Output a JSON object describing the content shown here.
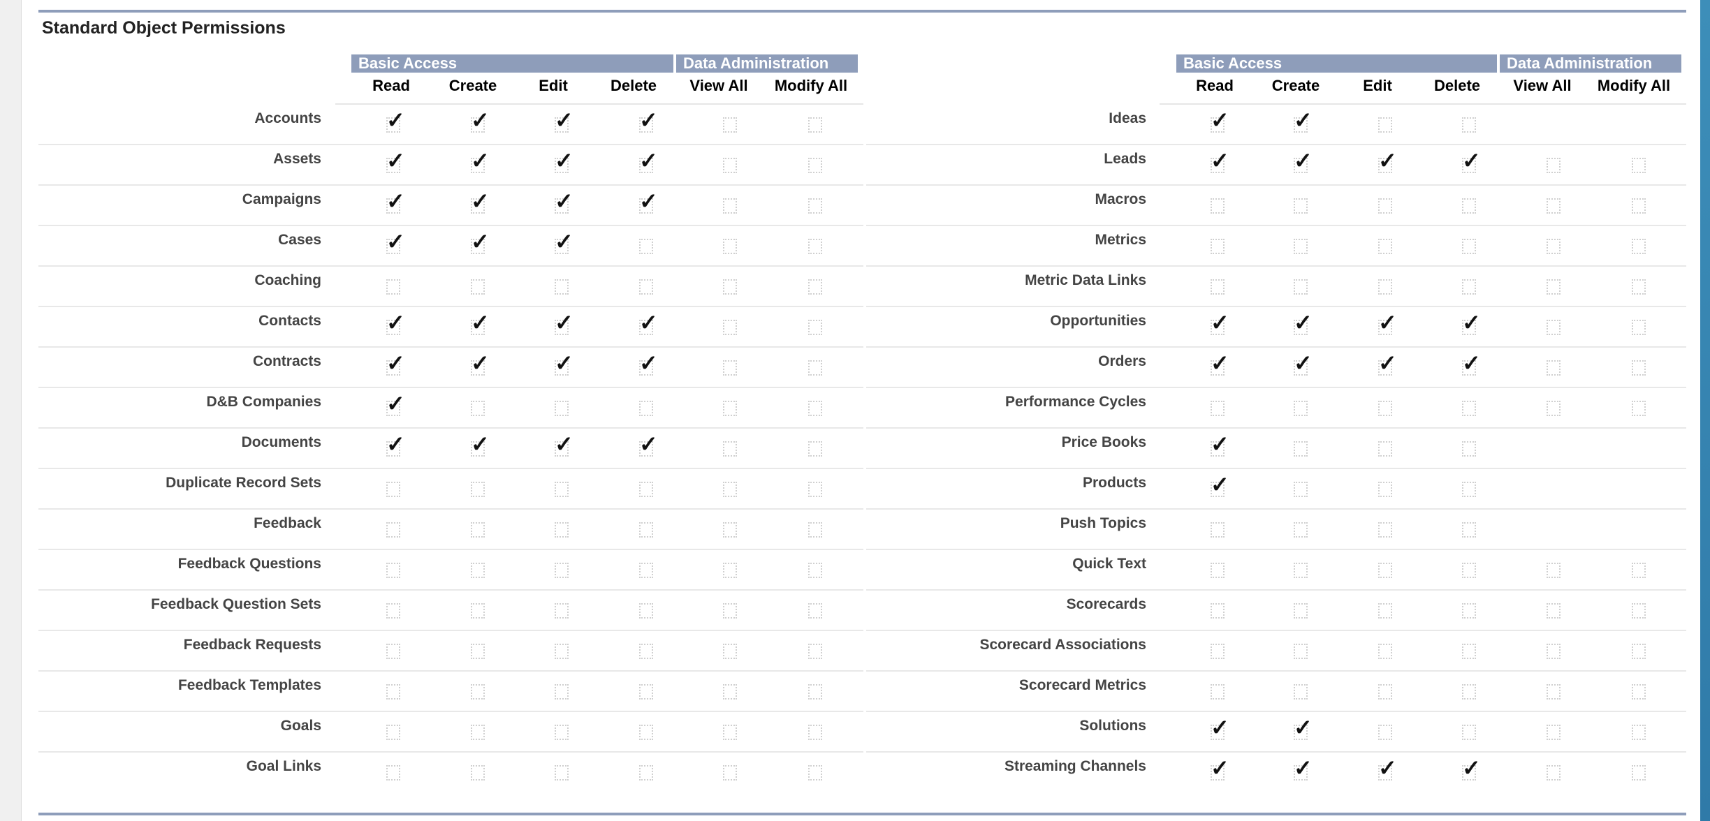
{
  "section": {
    "title": "Standard Object Permissions"
  },
  "header": {
    "group_basic": "Basic Access",
    "group_admin": "Data Administration",
    "columns": [
      "Read",
      "Create",
      "Edit",
      "Delete",
      "View All",
      "Modify All"
    ]
  },
  "icons": {
    "checked": "checkmark-icon",
    "unchecked": "empty-checkbox"
  },
  "colors": {
    "band": "#8e9dba",
    "rule": "#8e9dba",
    "right_strip": "#3d8eb9"
  },
  "left_table": {
    "rows": [
      {
        "name": "Accounts",
        "perms": [
          true,
          true,
          true,
          true,
          false,
          false
        ]
      },
      {
        "name": "Assets",
        "perms": [
          true,
          true,
          true,
          true,
          false,
          false
        ]
      },
      {
        "name": "Campaigns",
        "perms": [
          true,
          true,
          true,
          true,
          false,
          false
        ]
      },
      {
        "name": "Cases",
        "perms": [
          true,
          true,
          true,
          false,
          false,
          false
        ]
      },
      {
        "name": "Coaching",
        "perms": [
          false,
          false,
          false,
          false,
          false,
          false
        ]
      },
      {
        "name": "Contacts",
        "perms": [
          true,
          true,
          true,
          true,
          false,
          false
        ]
      },
      {
        "name": "Contracts",
        "perms": [
          true,
          true,
          true,
          true,
          false,
          false
        ]
      },
      {
        "name": "D&B Companies",
        "perms": [
          true,
          false,
          false,
          false,
          false,
          false
        ]
      },
      {
        "name": "Documents",
        "perms": [
          true,
          true,
          true,
          true,
          false,
          false
        ]
      },
      {
        "name": "Duplicate Record Sets",
        "perms": [
          false,
          false,
          false,
          false,
          false,
          false
        ]
      },
      {
        "name": "Feedback",
        "perms": [
          false,
          false,
          false,
          false,
          false,
          false
        ]
      },
      {
        "name": "Feedback Questions",
        "perms": [
          false,
          false,
          false,
          false,
          false,
          false
        ]
      },
      {
        "name": "Feedback Question Sets",
        "perms": [
          false,
          false,
          false,
          false,
          false,
          false
        ]
      },
      {
        "name": "Feedback Requests",
        "perms": [
          false,
          false,
          false,
          false,
          false,
          false
        ]
      },
      {
        "name": "Feedback Templates",
        "perms": [
          false,
          false,
          false,
          false,
          false,
          false
        ]
      },
      {
        "name": "Goals",
        "perms": [
          false,
          false,
          false,
          false,
          false,
          false
        ]
      },
      {
        "name": "Goal Links",
        "perms": [
          false,
          false,
          false,
          false,
          false,
          false
        ]
      }
    ]
  },
  "right_table": {
    "rows": [
      {
        "name": "Ideas",
        "perms": [
          true,
          true,
          false,
          false,
          null,
          null
        ]
      },
      {
        "name": "Leads",
        "perms": [
          true,
          true,
          true,
          true,
          false,
          false
        ]
      },
      {
        "name": "Macros",
        "perms": [
          false,
          false,
          false,
          false,
          false,
          false
        ]
      },
      {
        "name": "Metrics",
        "perms": [
          false,
          false,
          false,
          false,
          false,
          false
        ]
      },
      {
        "name": "Metric Data Links",
        "perms": [
          false,
          false,
          false,
          false,
          false,
          false
        ]
      },
      {
        "name": "Opportunities",
        "perms": [
          true,
          true,
          true,
          true,
          false,
          false
        ]
      },
      {
        "name": "Orders",
        "perms": [
          true,
          true,
          true,
          true,
          false,
          false
        ]
      },
      {
        "name": "Performance Cycles",
        "perms": [
          false,
          false,
          false,
          false,
          false,
          false
        ]
      },
      {
        "name": "Price Books",
        "perms": [
          true,
          false,
          false,
          false,
          null,
          null
        ]
      },
      {
        "name": "Products",
        "perms": [
          true,
          false,
          false,
          false,
          null,
          null
        ]
      },
      {
        "name": "Push Topics",
        "perms": [
          false,
          false,
          false,
          false,
          null,
          null
        ]
      },
      {
        "name": "Quick Text",
        "perms": [
          false,
          false,
          false,
          false,
          false,
          false
        ]
      },
      {
        "name": "Scorecards",
        "perms": [
          false,
          false,
          false,
          false,
          false,
          false
        ]
      },
      {
        "name": "Scorecard Associations",
        "perms": [
          false,
          false,
          false,
          false,
          false,
          false
        ]
      },
      {
        "name": "Scorecard Metrics",
        "perms": [
          false,
          false,
          false,
          false,
          false,
          false
        ]
      },
      {
        "name": "Solutions",
        "perms": [
          true,
          true,
          false,
          false,
          false,
          false
        ]
      },
      {
        "name": "Streaming Channels",
        "perms": [
          true,
          true,
          true,
          true,
          false,
          false
        ]
      }
    ]
  }
}
